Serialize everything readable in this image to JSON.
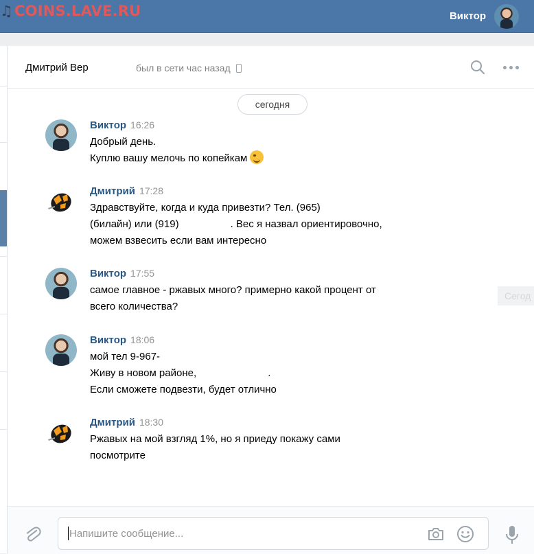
{
  "watermark": {
    "text": "COINS.LAVE.RU",
    "note_icon": "♫"
  },
  "topbar": {
    "user_name": "Виктор"
  },
  "header": {
    "peer_name": "Дмитрий Вер",
    "status": "был в сети час назад"
  },
  "date_separator": "сегодня",
  "messages": [
    {
      "author": "Виктор",
      "time": "16:26",
      "avatar": "viktor",
      "lines": [
        "Добрый день.",
        "Куплю вашу мелочь по копейкам"
      ],
      "emoji": "winking-face"
    },
    {
      "author": "Дмитрий",
      "time": "17:28",
      "avatar": "dmitry",
      "lines": [
        "Здравствуйте, когда и куда привезти? Тел. (965)",
        "(билайн) или (919)                  . Вес я назвал ориентировочно,",
        "можем взвесить если вам интересно"
      ]
    },
    {
      "author": "Виктор",
      "time": "17:55",
      "avatar": "viktor",
      "lines": [
        "самое главное - ржавых много? примерно какой процент от",
        "всего количества?"
      ]
    },
    {
      "author": "Виктор",
      "time": "18:06",
      "avatar": "viktor",
      "lines": [
        "мой тел 9-967-",
        "Живу в новом районе,                         .",
        "Если сможете подвезти, будет отлично"
      ]
    },
    {
      "author": "Дмитрий",
      "time": "18:30",
      "avatar": "dmitry",
      "lines": [
        "Ржавых на мой взгляд 1%, но я приеду покажу сами",
        "посмотрите"
      ]
    }
  ],
  "side_tip": "Сегод",
  "composer": {
    "placeholder": "Напишите сообщение..."
  },
  "colors": {
    "topbar": "#4a76a8",
    "author": "#2a5885",
    "time": "#939393",
    "watermark": "#e0585a"
  }
}
